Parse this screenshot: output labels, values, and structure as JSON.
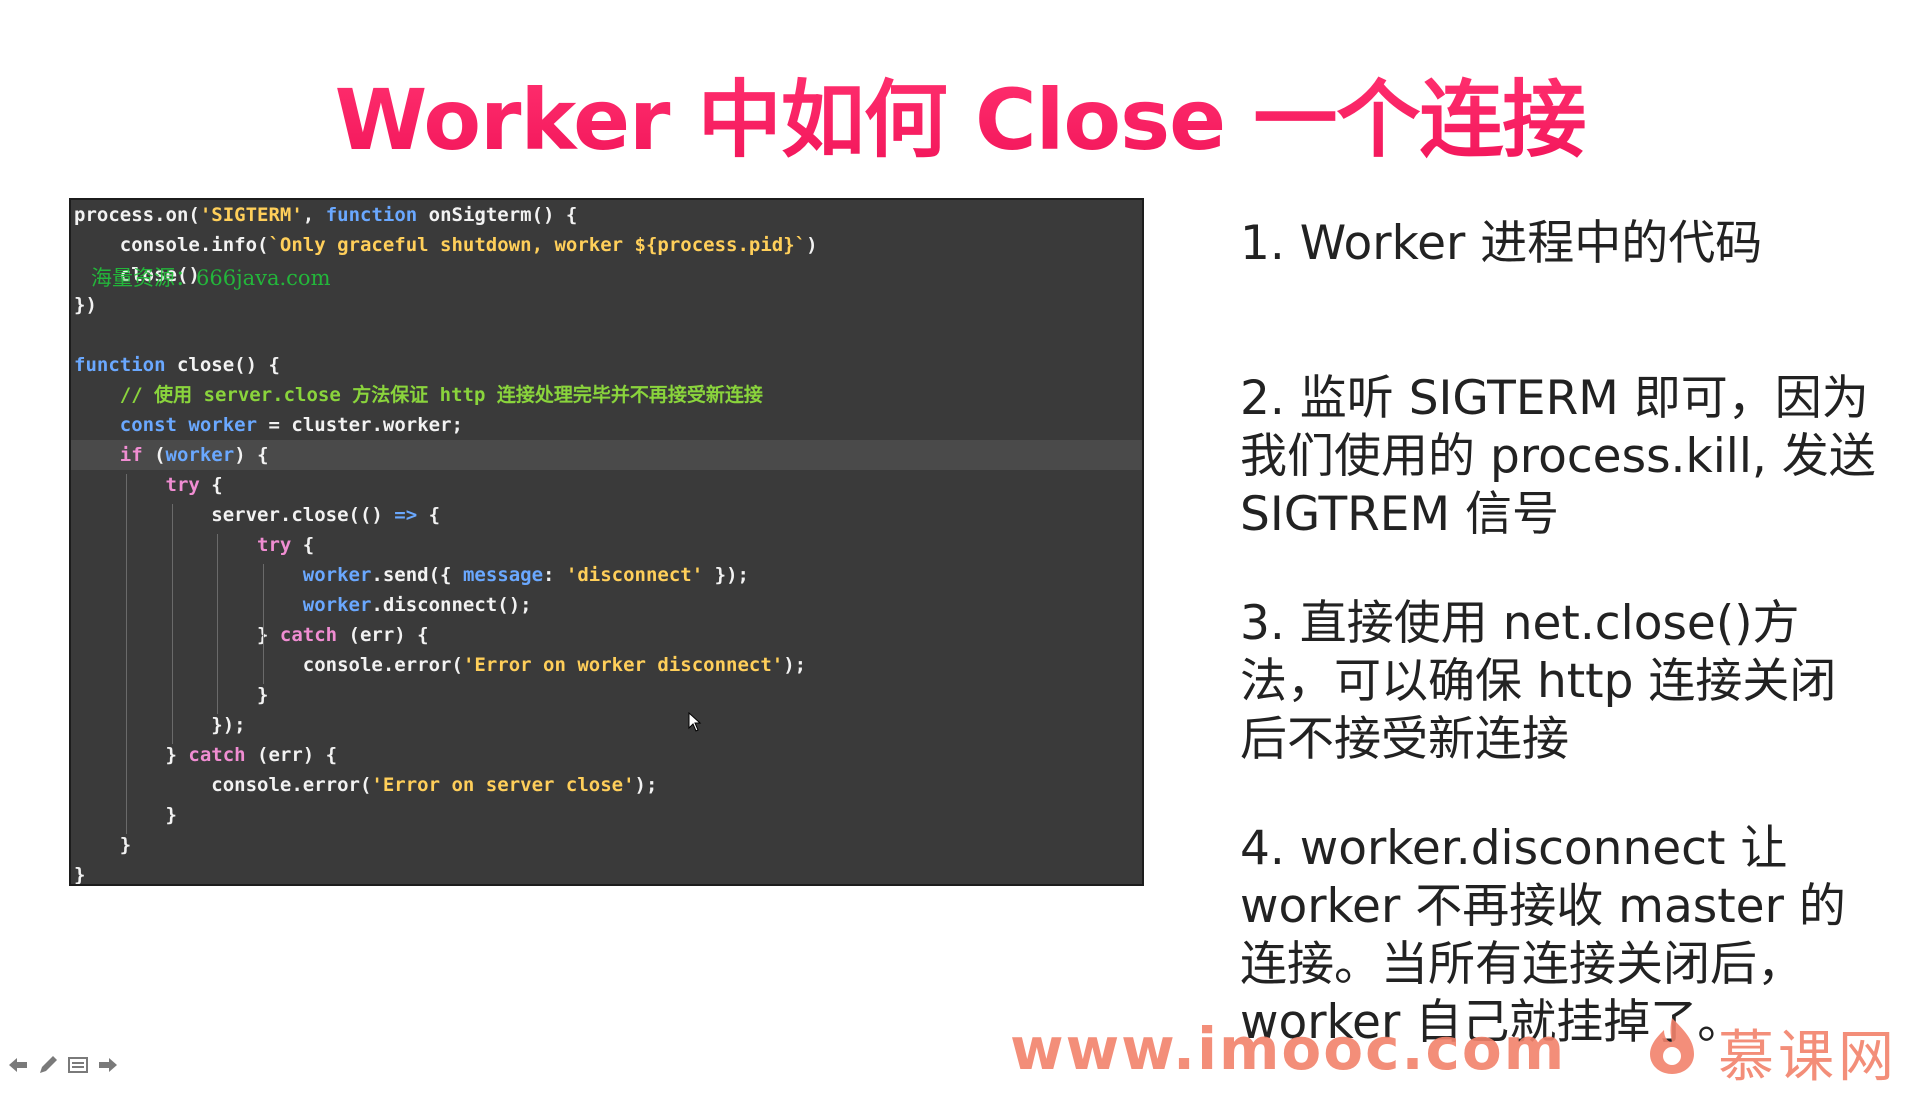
{
  "slide": {
    "title": "Worker 中如何 Close 一个连接"
  },
  "code": {
    "watermark": "海量资源：666java.com",
    "lines": [
      [
        [
          "plain",
          "process.on("
        ],
        [
          "str",
          "'SIGTERM'"
        ],
        [
          "plain",
          ", "
        ],
        [
          "fn",
          "function"
        ],
        [
          "plain",
          " onSigterm() {"
        ]
      ],
      [
        [
          "plain",
          "    console.info("
        ],
        [
          "str",
          "`Only graceful shutdown, worker ${process.pid}`"
        ],
        [
          "plain",
          ")"
        ]
      ],
      [
        [
          "plain",
          "    close()"
        ]
      ],
      [
        [
          "plain",
          "})"
        ]
      ],
      [
        [
          "plain",
          ""
        ]
      ],
      [
        [
          "fn",
          "function"
        ],
        [
          "plain",
          " close() {"
        ]
      ],
      [
        [
          "plain",
          "    "
        ],
        [
          "cm",
          "// 使用 server.close 方法保证 http 连接处理完毕并不再接受新连接"
        ]
      ],
      [
        [
          "plain",
          "    "
        ],
        [
          "fn",
          "const"
        ],
        [
          "plain",
          " "
        ],
        [
          "fn",
          "worker"
        ],
        [
          "plain",
          " = cluster.worker;"
        ]
      ],
      [
        [
          "plain",
          "    "
        ],
        [
          "kw",
          "if"
        ],
        [
          "plain",
          " ("
        ],
        [
          "fn",
          "worker"
        ],
        [
          "plain",
          ") {"
        ]
      ],
      [
        [
          "plain",
          "        "
        ],
        [
          "kw",
          "try"
        ],
        [
          "plain",
          " {"
        ]
      ],
      [
        [
          "plain",
          "            server.close(() "
        ],
        [
          "fn",
          "=>"
        ],
        [
          "plain",
          " {"
        ]
      ],
      [
        [
          "plain",
          "                "
        ],
        [
          "kw",
          "try"
        ],
        [
          "plain",
          " {"
        ]
      ],
      [
        [
          "plain",
          "                    "
        ],
        [
          "fn",
          "worker"
        ],
        [
          "plain",
          ".send({ "
        ],
        [
          "fn",
          "message"
        ],
        [
          "plain",
          ": "
        ],
        [
          "str",
          "'disconnect'"
        ],
        [
          "plain",
          " });"
        ]
      ],
      [
        [
          "plain",
          "                    "
        ],
        [
          "fn",
          "worker"
        ],
        [
          "plain",
          ".disconnect();"
        ]
      ],
      [
        [
          "plain",
          "                } "
        ],
        [
          "kw",
          "catch"
        ],
        [
          "plain",
          " (err) {"
        ]
      ],
      [
        [
          "plain",
          "                    console.error("
        ],
        [
          "str",
          "'Error on worker disconnect'"
        ],
        [
          "plain",
          ");"
        ]
      ],
      [
        [
          "plain",
          "                }"
        ]
      ],
      [
        [
          "plain",
          "            });"
        ]
      ],
      [
        [
          "plain",
          "        } "
        ],
        [
          "kw",
          "catch"
        ],
        [
          "plain",
          " (err) {"
        ]
      ],
      [
        [
          "plain",
          "            console.error("
        ],
        [
          "str",
          "'Error on server close'"
        ],
        [
          "plain",
          ");"
        ]
      ],
      [
        [
          "plain",
          "        }"
        ]
      ],
      [
        [
          "plain",
          "    }"
        ]
      ],
      [
        [
          "plain",
          "}"
        ]
      ]
    ],
    "highlighted_line": 8
  },
  "notes": {
    "note1": "1. Worker 进程中的代码",
    "note2": "2. 监听 SIGTERM 即可，因为我们使用的 process.kill, 发送 SIGTREM 信号",
    "note3": "3. 直接使用 net.close()方法，可以确保 http 连接关闭后不接受新连接",
    "note4": "4. worker.disconnect 让 worker 不再接收 master 的连接。当所有连接关闭后，worker 自己就挂掉了。"
  },
  "brand": {
    "url": "www.imooc.com",
    "name": "慕课网",
    "logo_icon": "imooc-flame-logo"
  },
  "player": {
    "controls": [
      "prev-arrow-icon",
      "pen-icon",
      "menu-icon",
      "next-arrow-icon"
    ]
  },
  "colors": {
    "title": "#f2155a",
    "code_bg": "#3a3a3a",
    "keyword": "#f08dd2",
    "function": "#6aa8ff",
    "string": "#ffcf5a",
    "comment": "#8ad43c",
    "brand": "#f2826b"
  }
}
